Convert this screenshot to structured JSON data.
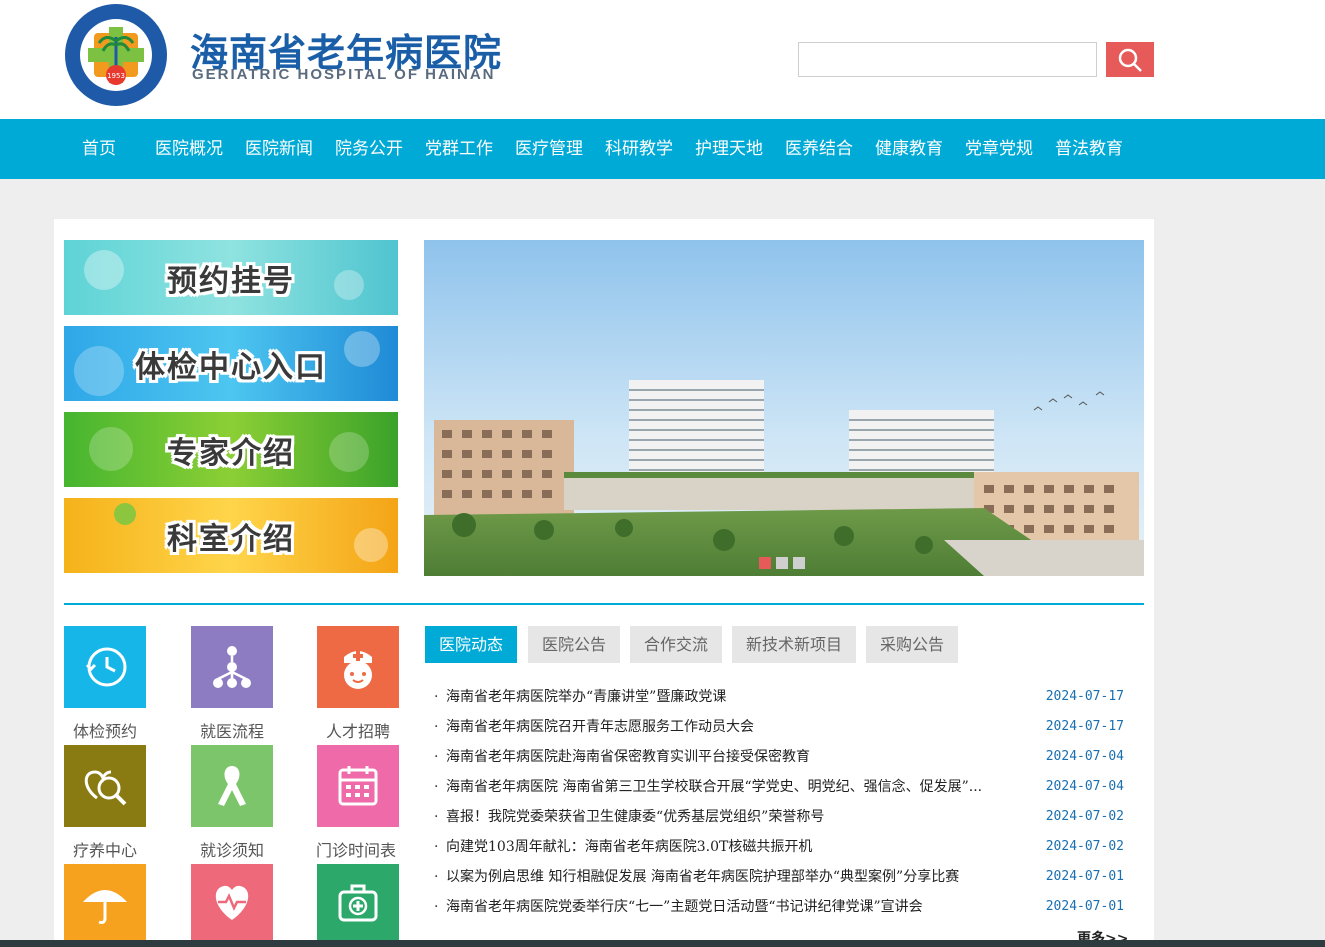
{
  "header": {
    "title_cn": "海南省老年病医院",
    "title_en": "GERIATRIC HOSPITAL OF HAINAN",
    "seal_text_top": "海南省老年病医院",
    "seal_text_bottom": "GERIATRIC HOSPITAL OF HAINAN",
    "seal_year": "1953",
    "search": {
      "value": "",
      "placeholder": ""
    }
  },
  "nav": {
    "items": [
      "首页",
      "医院概况",
      "医院新闻",
      "院务公开",
      "党群工作",
      "医疗管理",
      "科研教学",
      "护理天地",
      "医养结合",
      "健康教育",
      "党章党规",
      "普法教育"
    ]
  },
  "entries": [
    {
      "label": "预约挂号"
    },
    {
      "label": "体检中心入口"
    },
    {
      "label": "专家介绍"
    },
    {
      "label": "科室介绍"
    }
  ],
  "banner": {
    "slide_count": 3,
    "active_slide": 1
  },
  "quick_links": [
    {
      "label": "体检预约",
      "icon": "clock-icon",
      "color": "#16b7e8"
    },
    {
      "label": "就医流程",
      "icon": "flow-icon",
      "color": "#8e7cc3"
    },
    {
      "label": "人才招聘",
      "icon": "nurse-icon",
      "color": "#ee6a44"
    },
    {
      "label": "疗养中心",
      "icon": "heart-magnifier-icon",
      "color": "#8a7a12"
    },
    {
      "label": "就诊须知",
      "icon": "ribbon-icon",
      "color": "#7cc56a"
    },
    {
      "label": "门诊时间表",
      "icon": "calendar-icon",
      "color": "#ee6aa8"
    },
    {
      "label": "",
      "icon": "umbrella-icon",
      "color": "#f7a21e"
    },
    {
      "label": "",
      "icon": "heart-pulse-icon",
      "color": "#ee6a7a"
    },
    {
      "label": "",
      "icon": "medkit-icon",
      "color": "#2ba86a"
    }
  ],
  "tabs": [
    "医院动态",
    "医院公告",
    "合作交流",
    "新技术新项目",
    "采购公告"
  ],
  "news": [
    {
      "title": "海南省老年病医院举办“青廉讲堂”暨廉政党课",
      "date": "2024-07-17"
    },
    {
      "title": "海南省老年病医院召开青年志愿服务工作动员大会",
      "date": "2024-07-17"
    },
    {
      "title": "海南省老年病医院赴海南省保密教育实训平台接受保密教育",
      "date": "2024-07-04"
    },
    {
      "title": "海南省老年病医院 海南省第三卫生学校联合开展“学党史、明党纪、强信念、促发展”...",
      "date": "2024-07-04"
    },
    {
      "title": "喜报！我院党委荣获省卫生健康委“优秀基层党组织”荣誉称号",
      "date": "2024-07-02"
    },
    {
      "title": "向建党103周年献礼：海南省老年病医院3.0T核磁共振开机",
      "date": "2024-07-02"
    },
    {
      "title": "以案为例启思维 知行相融促发展 海南省老年病医院护理部举办“典型案例”分享比赛",
      "date": "2024-07-01"
    },
    {
      "title": "海南省老年病医院党委举行庆“七一”主题党日活动暨“书记讲纪律党课”宣讲会",
      "date": "2024-07-01"
    }
  ],
  "more_label": "更多>>",
  "colors": {
    "nav": "#00aad6",
    "search_button": "#e65a5a",
    "date": "#1a6fb0"
  }
}
